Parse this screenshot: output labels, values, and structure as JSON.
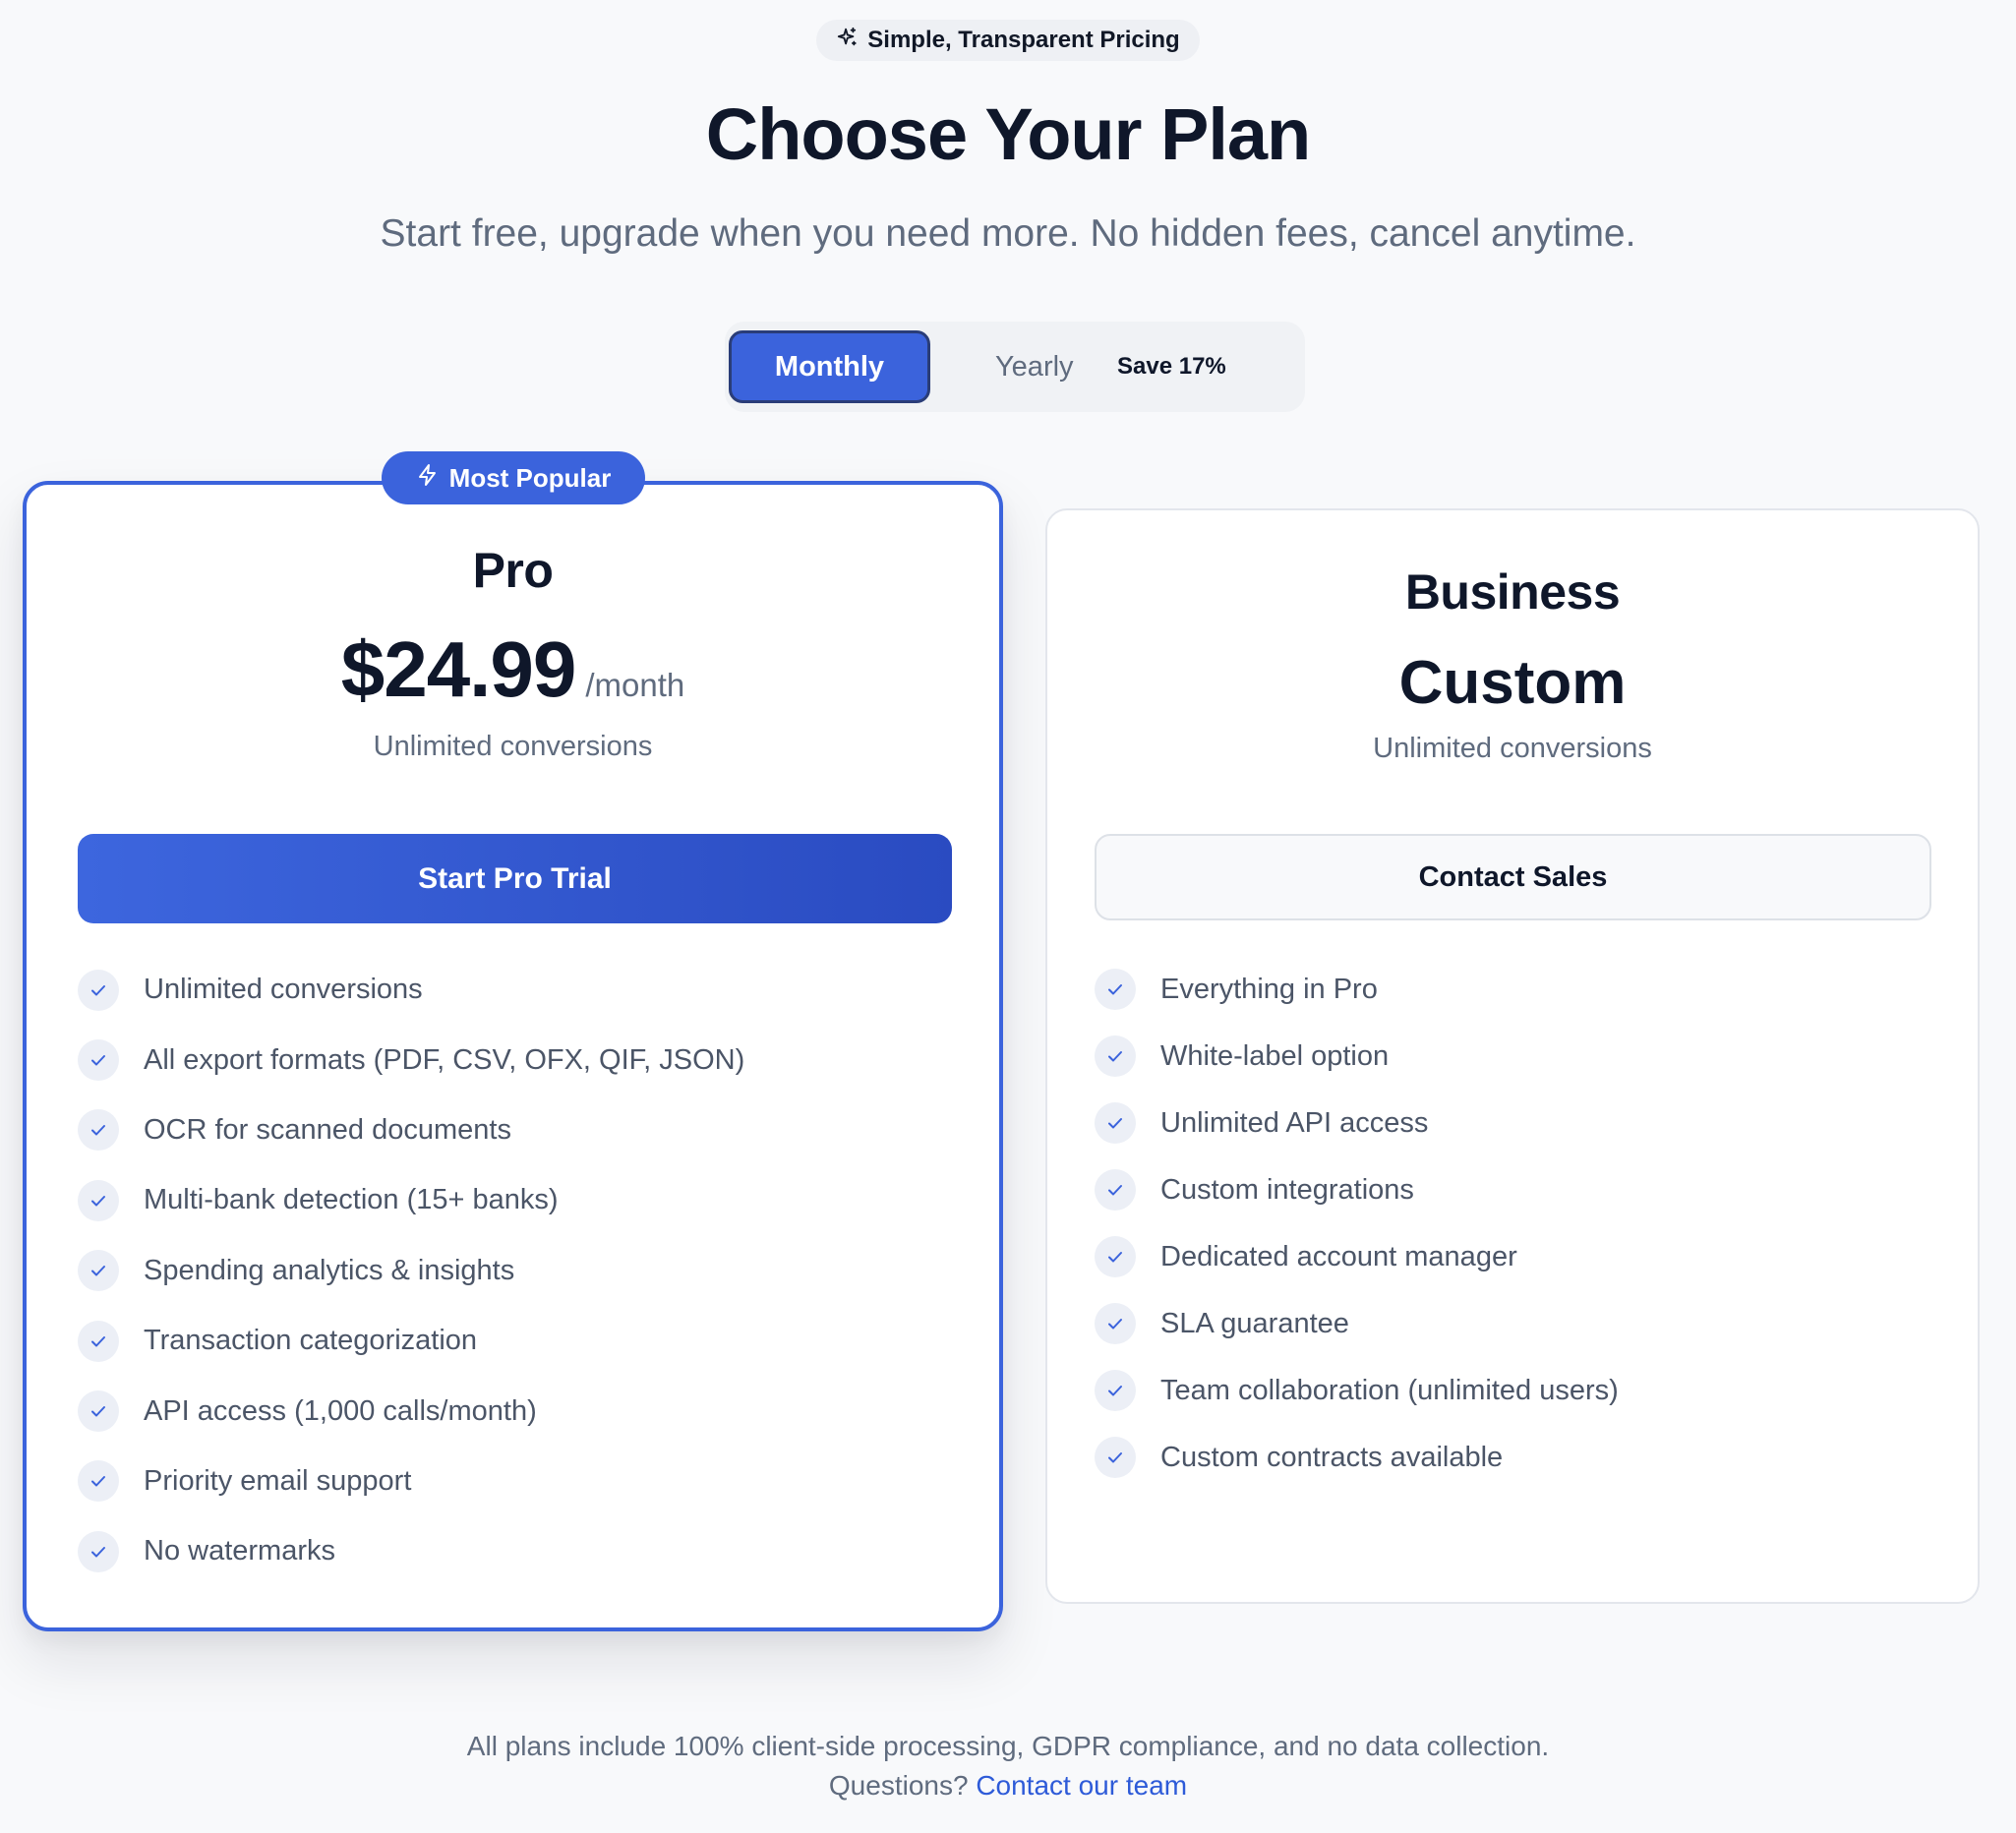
{
  "header": {
    "badge_icon": "sparkles-icon",
    "badge_text": "Simple, Transparent Pricing",
    "title": "Choose Your Plan",
    "subtitle": "Start free, upgrade when you need more. No hidden fees, cancel anytime."
  },
  "billing_toggle": {
    "monthly_label": "Monthly",
    "yearly_label": "Yearly",
    "save_label": "Save 17%",
    "selected": "Monthly"
  },
  "plans": [
    {
      "badge_icon": "lightning-icon",
      "badge": "Most Popular",
      "name": "Pro",
      "price": "$24.99",
      "period": "/month",
      "description": "Unlimited conversions",
      "cta": "Start Pro Trial",
      "features": [
        "Unlimited conversions",
        "All export formats (PDF, CSV, OFX, QIF, JSON)",
        "OCR for scanned documents",
        "Multi-bank detection (15+ banks)",
        "Spending analytics & insights",
        "Transaction categorization",
        "API access (1,000 calls/month)",
        "Priority email support",
        "No watermarks"
      ]
    },
    {
      "name": "Business",
      "price": "Custom",
      "description": "Unlimited conversions",
      "cta": "Contact Sales",
      "features": [
        "Everything in Pro",
        "White-label option",
        "Unlimited API access",
        "Custom integrations",
        "Dedicated account manager",
        "SLA guarantee",
        "Team collaboration (unlimited users)",
        "Custom contracts available"
      ]
    }
  ],
  "footer": {
    "note": "All plans include 100% client-side processing, GDPR compliance, and no data collection.",
    "question": "Questions?",
    "link_text": "Contact our team"
  },
  "colors": {
    "accent": "#3b63dc",
    "background": "#f8f9fb",
    "text_primary": "#0f172a",
    "text_muted": "#5f6b7e",
    "link": "#2e5bd8"
  }
}
